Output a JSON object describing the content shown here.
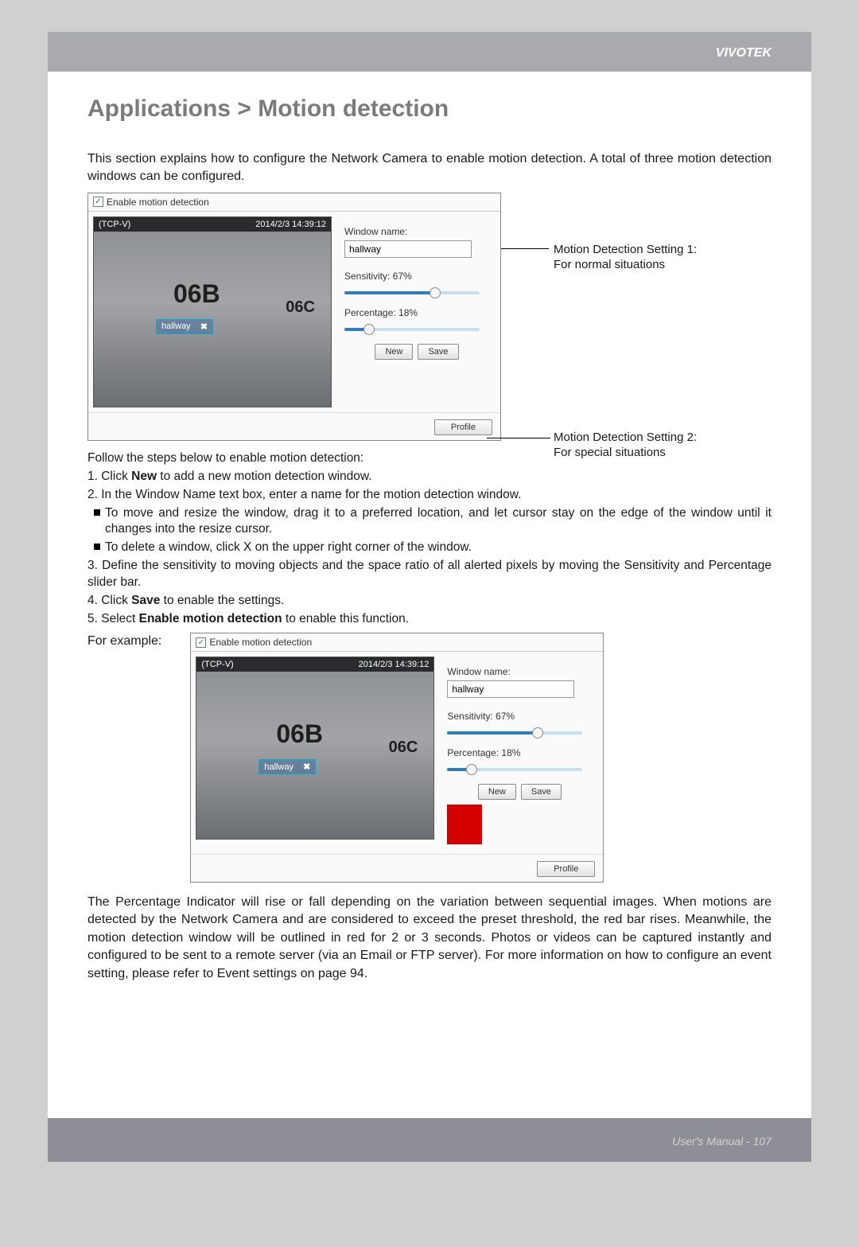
{
  "brand": "VIVOTEK",
  "title": "Applications > Motion detection",
  "intro": "This section explains how to configure the Network Camera to enable motion detection. A total of three motion detection windows can be configured.",
  "screenshot1": {
    "enable_label": "Enable motion detection",
    "cam_name": "(TCP-V)",
    "timestamp": "2014/2/3 14:39:12",
    "door_label_1": "06B",
    "door_label_2": "06C",
    "md_window_name": "hallway",
    "settings": {
      "window_name_label": "Window name:",
      "window_name_value": "hallway",
      "sensitivity_label": "Sensitivity: 67%",
      "sensitivity_value": 67,
      "percentage_label": "Percentage: 18%",
      "percentage_value": 18,
      "new_btn": "New",
      "save_btn": "Save",
      "profile_btn": "Profile"
    }
  },
  "annotations": {
    "setting1_line1": "Motion Detection Setting 1:",
    "setting1_line2": "For normal situations",
    "setting2_line1": "Motion Detection Setting 2:",
    "setting2_line2": "For special situations"
  },
  "steps_intro": "Follow the steps below to enable motion detection:",
  "step1_pre": "1. Click ",
  "step1_bold": "New",
  "step1_post": " to add a new motion detection window.",
  "step2": "2. In the Window Name text box, enter a name for the motion detection window.",
  "step2_b1": "To move and resize the window, drag it to a preferred location, and let cursor stay on the edge of the window until it changes into the resize cursor.",
  "step2_b2": "To delete a window, click X on the upper right corner of the window.",
  "step3": "3. Define the sensitivity to moving objects and the space ratio of all alerted pixels by moving the Sensitivity and Percentage slider bar.",
  "step4_pre": "4. Click ",
  "step4_bold": "Save",
  "step4_post": " to enable the settings.",
  "step5_pre": "5. Select ",
  "step5_bold": "Enable motion detection",
  "step5_post": " to enable this function.",
  "example_label": "For example:",
  "para2": "The Percentage Indicator will rise or fall depending on the variation between sequential images. When motions are detected by the Network Camera and are considered to exceed the preset threshold, the red bar rises. Meanwhile, the motion detection window will be outlined in red for 2 or 3 seconds. Photos or videos can be captured instantly and configured to be sent to a remote server (via an Email or FTP server). For more information on how to configure an event setting, please refer to Event settings on page 94.",
  "footer_text": "User's Manual - ",
  "page_number": "107"
}
